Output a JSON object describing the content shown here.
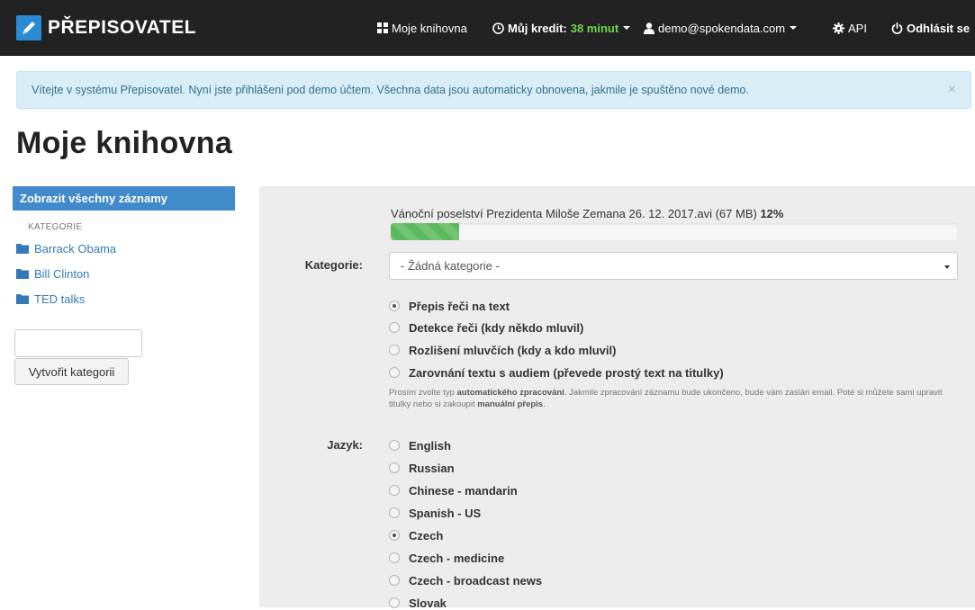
{
  "navbar": {
    "brand": "PŘEPISOVATEL",
    "library": "Moje knihovna",
    "credit_label": "Můj kredit:",
    "credit_value": "38 minut",
    "user": "demo@spokendata.com",
    "api": "API",
    "logout": "Odhlásit se"
  },
  "alert": {
    "text": "Vítejte v systému Přepisovatel. Nyní jste přihlášeni pod demo účtem. Všechna data jsou automaticky obnovena, jakmile je spuštěno nové demo.",
    "close": "×"
  },
  "page": {
    "title": "Moje knihovna"
  },
  "sidebar": {
    "all_records": "Zobrazit všechny záznamy",
    "category_heading": "KATEGORIE",
    "categories": [
      "Barrack Obama",
      "Bill Clinton",
      "TED talks"
    ],
    "new_category_input": "",
    "create_button": "Vytvořit kategorii"
  },
  "upload": {
    "file_name": "Vánoční poselství Prezidenta Miloše Zemana 26. 12. 2017.avi (67 MB)",
    "progress_text": "12%",
    "progress": 0.12
  },
  "form": {
    "category_label": "Kategorie:",
    "category_value": "- Žádná kategorie -",
    "processing_options": [
      {
        "label": "Přepis řeči na text",
        "checked": true
      },
      {
        "label": "Detekce řeči (kdy někdo mluvil)",
        "checked": false
      },
      {
        "label": "Rozlišení mluvčích (kdy a kdo mluvil)",
        "checked": false
      },
      {
        "label": "Zarovnání textu s audiem (převede prostý text na titulky)",
        "checked": false
      }
    ],
    "help": {
      "part1": "Prosím zvolte typ ",
      "bold1": "automatického zpracování",
      "part2": ". Jakmile zpracování záznamu bude ukončeno, bude vám zaslán email. Poté si můžete sami upravit titulky nebo si zakoupit ",
      "bold2": "manuální přepis",
      "part3": "."
    },
    "language_label": "Jazyk:",
    "languages": [
      {
        "label": "English",
        "checked": false
      },
      {
        "label": "Russian",
        "checked": false
      },
      {
        "label": "Chinese - mandarin",
        "checked": false
      },
      {
        "label": "Spanish - US",
        "checked": false
      },
      {
        "label": "Czech",
        "checked": true
      },
      {
        "label": "Czech - medicine",
        "checked": false
      },
      {
        "label": "Czech - broadcast news",
        "checked": false
      },
      {
        "label": "Slovak",
        "checked": false
      }
    ]
  }
}
